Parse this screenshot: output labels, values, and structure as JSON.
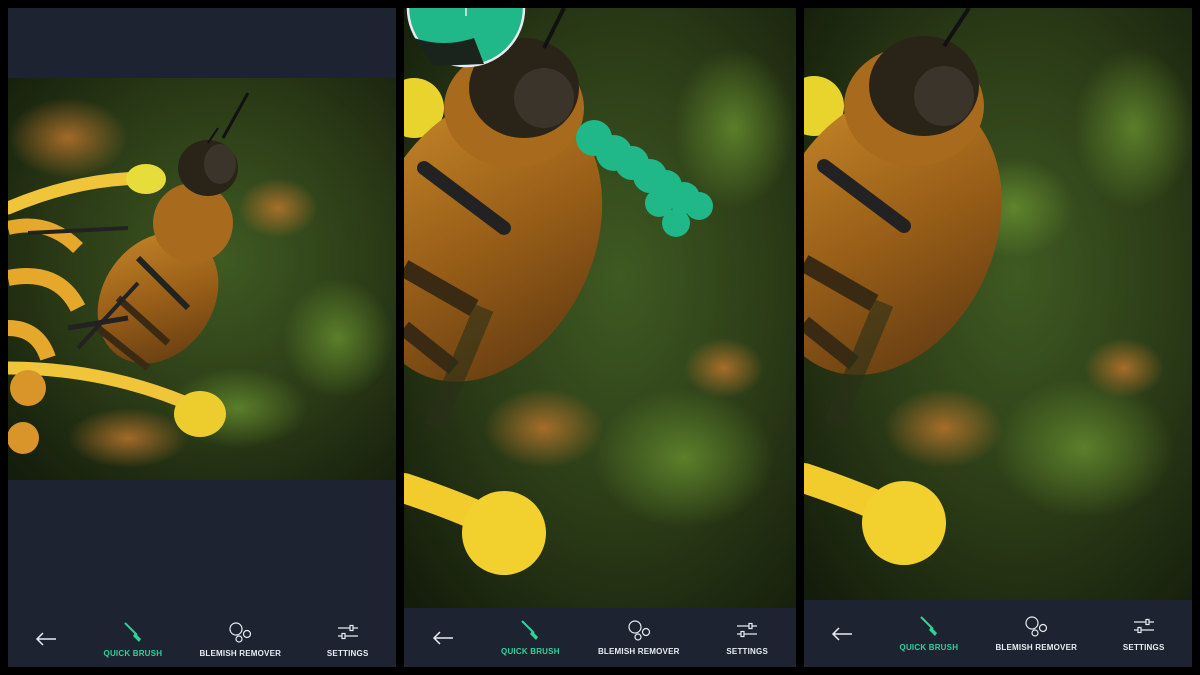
{
  "colors": {
    "toolbar_bg": "#1d2330",
    "accent": "#2fd39a",
    "brush_overlay": "#20b889",
    "icon_default": "#e8ecf2"
  },
  "screens": [
    {
      "id": "screen-1",
      "state": "original",
      "toolbar": {
        "back_icon": "arrow-left-icon",
        "tools": [
          {
            "label": "QUICK BRUSH",
            "icon": "brush-icon",
            "active": true
          },
          {
            "label": "BLEMISH REMOVER",
            "icon": "blemish-circles-icon",
            "active": false
          },
          {
            "label": "SETTINGS",
            "icon": "sliders-icon",
            "active": false
          }
        ]
      }
    },
    {
      "id": "screen-2",
      "state": "brushing",
      "toolbar": {
        "back_icon": "arrow-left-icon",
        "tools": [
          {
            "label": "QUICK BRUSH",
            "icon": "brush-icon",
            "active": true
          },
          {
            "label": "BLEMISH REMOVER",
            "icon": "blemish-circles-icon",
            "active": false
          },
          {
            "label": "SETTINGS",
            "icon": "sliders-icon",
            "active": false
          }
        ]
      }
    },
    {
      "id": "screen-3",
      "state": "result",
      "toolbar": {
        "back_icon": "arrow-left-icon",
        "tools": [
          {
            "label": "QUICK BRUSH",
            "icon": "brush-icon",
            "active": true
          },
          {
            "label": "BLEMISH REMOVER",
            "icon": "blemish-circles-icon",
            "active": false
          },
          {
            "label": "SETTINGS",
            "icon": "sliders-icon",
            "active": false
          }
        ]
      }
    }
  ]
}
